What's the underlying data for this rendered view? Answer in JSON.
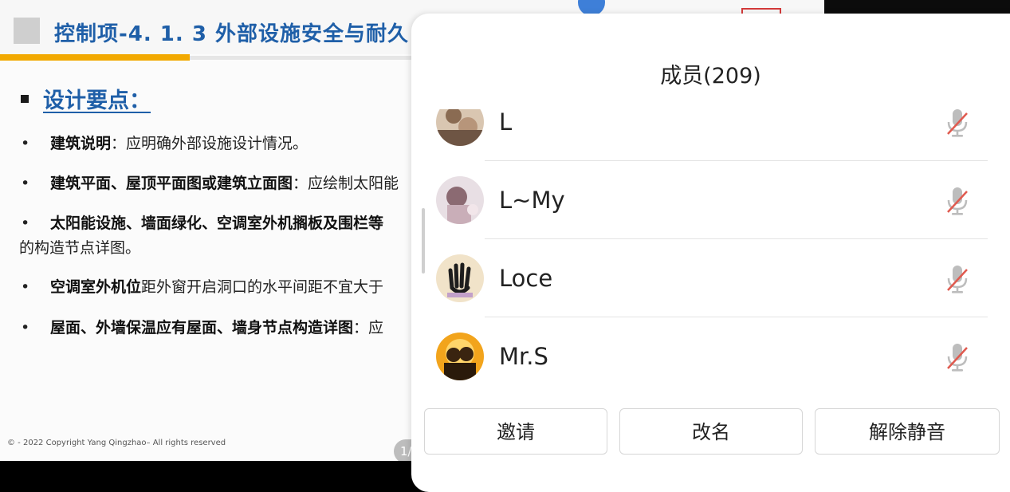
{
  "slide": {
    "title": "控制项-4. 1. 3  外部设施安全与耐久",
    "section_title": "设计要点：",
    "points": [
      {
        "bold": "建筑说明",
        "text": "：应明确外部设施设计情况。"
      },
      {
        "bold": "建筑平面、屋顶平面图或建筑立面图",
        "text": "：应绘制太阳能"
      },
      {
        "bold": "太阳能设施、墙面绿化、空调室外机搁板及围栏等",
        "text": ""
      },
      {
        "bold": "空调室外机位",
        "text": "距外窗开启洞口的水平间距不宜大于"
      },
      {
        "bold": "屋面、外墙保温应有屋面、墙身节点构造详图",
        "text": "：应"
      }
    ],
    "continuation": "的构造节点详图。",
    "footer": "© - 2022 Copyright  Yang Qingzhao– All rights reserved",
    "page_badge": "1/"
  },
  "panel": {
    "title": "成员(209)",
    "members": [
      {
        "name": "L",
        "muted": true,
        "avatar_icon": "photo-avatar-icon"
      },
      {
        "name": "L~My",
        "muted": true,
        "avatar_icon": "photo-avatar-icon"
      },
      {
        "name": "Loce",
        "muted": true,
        "avatar_icon": "handprint-avatar-icon"
      },
      {
        "name": "Mr.S",
        "muted": true,
        "avatar_icon": "silhouette-avatar-icon"
      }
    ],
    "buttons": {
      "invite": "邀请",
      "rename": "改名",
      "unmute": "解除静音"
    }
  },
  "colors": {
    "slide_title": "#1f5fa8",
    "title_rule": "#f2a900",
    "mic_muted_slash": "#e05a4f"
  }
}
